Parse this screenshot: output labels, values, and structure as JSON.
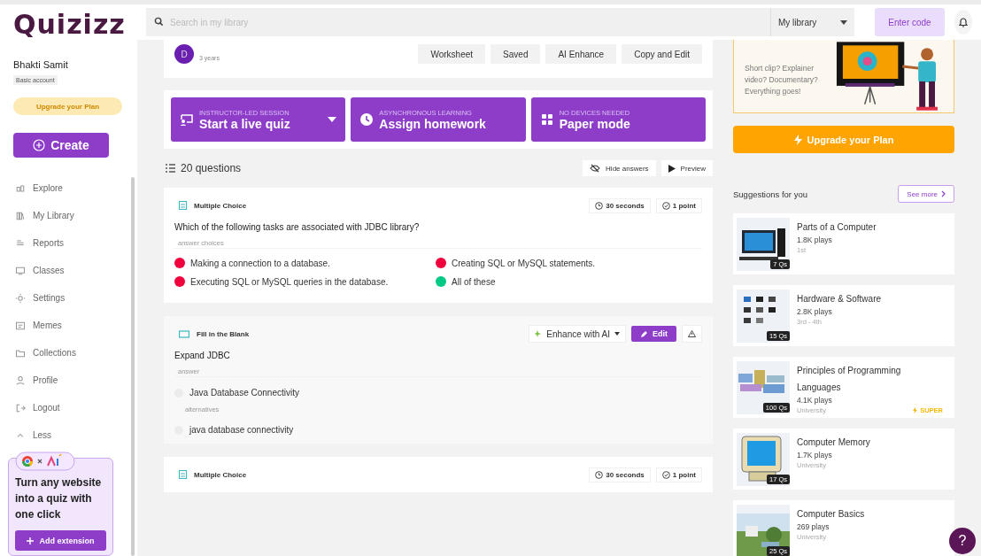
{
  "logo": "Quizizz",
  "user": {
    "name": "Bhakti Samit",
    "plan": "Basic account"
  },
  "sidebar": {
    "upgrade": "Upgrade your Plan",
    "create": "Create",
    "items": [
      {
        "label": "Explore"
      },
      {
        "label": "My Library"
      },
      {
        "label": "Reports"
      },
      {
        "label": "Classes"
      },
      {
        "label": "Settings"
      },
      {
        "label": "Memes"
      },
      {
        "label": "Collections"
      },
      {
        "label": "Profile"
      },
      {
        "label": "Logout"
      },
      {
        "label": "Less"
      }
    ],
    "extension": {
      "text": "Turn any website into a quiz with one click",
      "button": "Add extension"
    }
  },
  "topbar": {
    "placeholder": "Search in my library",
    "scope": "My library",
    "enter_code": "Enter code"
  },
  "quiz": {
    "avatar": "D",
    "age": "3 years",
    "actions": [
      "Worksheet",
      "Saved",
      "AI Enhance",
      "Copy and Edit"
    ]
  },
  "modes": [
    {
      "kicker": "INSTRUCTOR-LED SESSION",
      "label": "Start a live quiz",
      "dropdown": true
    },
    {
      "kicker": "ASYNCHRONOUS LEARNING",
      "label": "Assign homework",
      "dropdown": false
    },
    {
      "kicker": "NO DEVICES NEEDED",
      "label": "Paper mode",
      "dropdown": false
    }
  ],
  "questions_count": "20 questions",
  "hide_answers": "Hide answers",
  "preview": "Preview",
  "questions": [
    {
      "kind": "choice",
      "type": "Multiple Choice",
      "time": "30 seconds",
      "points": "1 point",
      "text": "Which of the following tasks are associated with JDBC library?",
      "section_label": "answer choices",
      "choices": [
        {
          "text": "Making a connection to a database.",
          "correct": false
        },
        {
          "text": "Creating SQL or MySQL statements.",
          "correct": false
        },
        {
          "text": "Executing SQL or MySQL queries in the database.",
          "correct": false
        },
        {
          "text": "All of these",
          "correct": true
        }
      ]
    },
    {
      "kind": "blank",
      "type": "Fill in the Blank",
      "enhance": "Enhance with AI",
      "edit": "Edit",
      "text": "Expand JDBC",
      "answer_label": "answer",
      "answer": "Java Database Connectivity",
      "alternatives_label": "alternatives",
      "alternatives": [
        "java database connectivity"
      ]
    },
    {
      "kind": "choice",
      "type": "Multiple Choice",
      "time": "30 seconds",
      "points": "1 point"
    }
  ],
  "promo": {
    "text": "Short clip? Explainer video? Documentary? Everything goes!",
    "upgrade": "Upgrade your Plan"
  },
  "suggestions": {
    "title": "Suggestions for you",
    "see_more": "See more",
    "items": [
      {
        "title": "Parts of a Computer",
        "plays": "1.8K plays",
        "grade": "1st",
        "count": "7 Qs"
      },
      {
        "title": "Hardware & Software",
        "plays": "2.8K plays",
        "grade": "3rd - 4th",
        "count": "15 Qs"
      },
      {
        "title": "Principles of Programming Languages",
        "plays": "4.1K plays",
        "grade": "University",
        "count": "100 Qs",
        "badge": "SUPER"
      },
      {
        "title": "Computer Memory",
        "plays": "1.7K plays",
        "grade": "University",
        "count": "17 Qs"
      },
      {
        "title": "Computer Basics",
        "plays": "269 plays",
        "grade": "University",
        "count": "25 Qs"
      }
    ]
  },
  "help": "?"
}
